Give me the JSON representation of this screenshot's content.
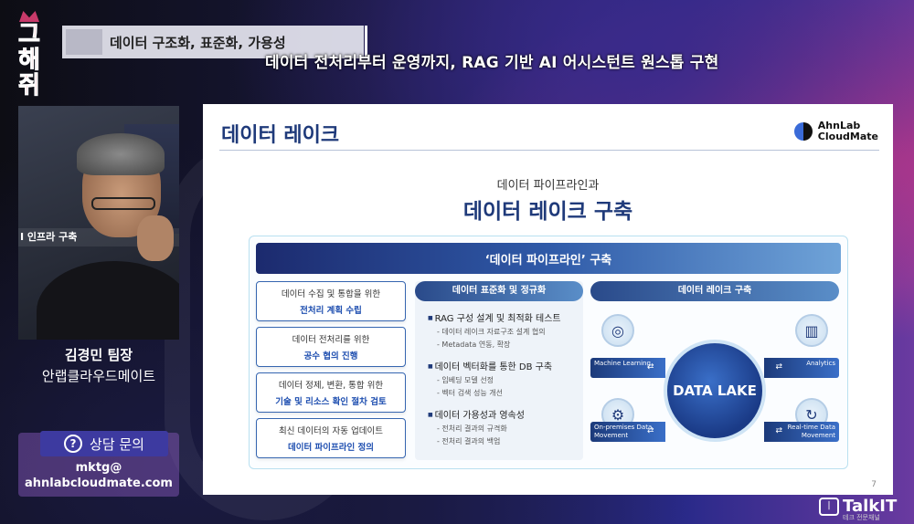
{
  "header": {
    "section_title": "데이터 구조화, 표준화, 가용성",
    "subtitle": "데이터 전처리부터 운영까지, RAG 기반 AI 어시스턴트 원스톱 구현"
  },
  "logo": {
    "chars": [
      "그",
      "해",
      "쥐"
    ]
  },
  "camera": {
    "background_banner": "I 인프라 구축"
  },
  "speaker": {
    "name": "김경민 팀장",
    "company": "안랩클라우드메이트"
  },
  "contact": {
    "label": "상담 문의",
    "line1": "mktg@",
    "line2": "ahnlabcloudmate.com"
  },
  "slide": {
    "title": "데이터 레이크",
    "brand_line1": "AhnLab",
    "brand_line2": "CloudMate",
    "kicker": "데이터 파이프라인과",
    "headline": "데이터 레이크 구축",
    "band_label": "‘데이터 파이프라인’ 구축",
    "steps": [
      {
        "line1": "데이터 수집 및 통합을 위한",
        "line2": "전처리 계획 수립"
      },
      {
        "line1": "데이터 전처리를 위한",
        "line2": "공수 협의 진행"
      },
      {
        "line1": "데이터 정제, 변환, 통합 위한",
        "line2": "기술 및 리소스 확인 절차 검토"
      },
      {
        "line1": "최신 데이터의 자동 업데이트",
        "line2": "데이터 파이프라인 정의"
      }
    ],
    "mid_header": "데이터 표준화 및 정규화",
    "mid_items": [
      {
        "main": "RAG 구성 설계 및 최적화 테스트",
        "subs": [
          "- 데이터 레이크 자료구조 설계 협의",
          "- Metadata 연동, 확장"
        ]
      },
      {
        "main": "데이터 벡터화를 통한 DB 구축",
        "subs": [
          "- 임베딩 모델 선정",
          "- 벡터 검색 성능 개선"
        ]
      },
      {
        "main": "데이터 가용성과 영속성",
        "subs": [
          "- 전처리 결과의 규격화",
          "- 전처리 결과의 백업"
        ]
      }
    ],
    "right_header": "데이터 레이크 구축",
    "lake_label": "DATA LAKE",
    "flows": {
      "top_left": "Machine Learning",
      "top_right": "Analytics",
      "bottom_left": "On-premises Data Movement",
      "bottom_right": "Real-time Data Movement"
    },
    "page_number": "7"
  },
  "talkit": {
    "word": "TalkIT",
    "tagline": "테크 전문채널"
  }
}
